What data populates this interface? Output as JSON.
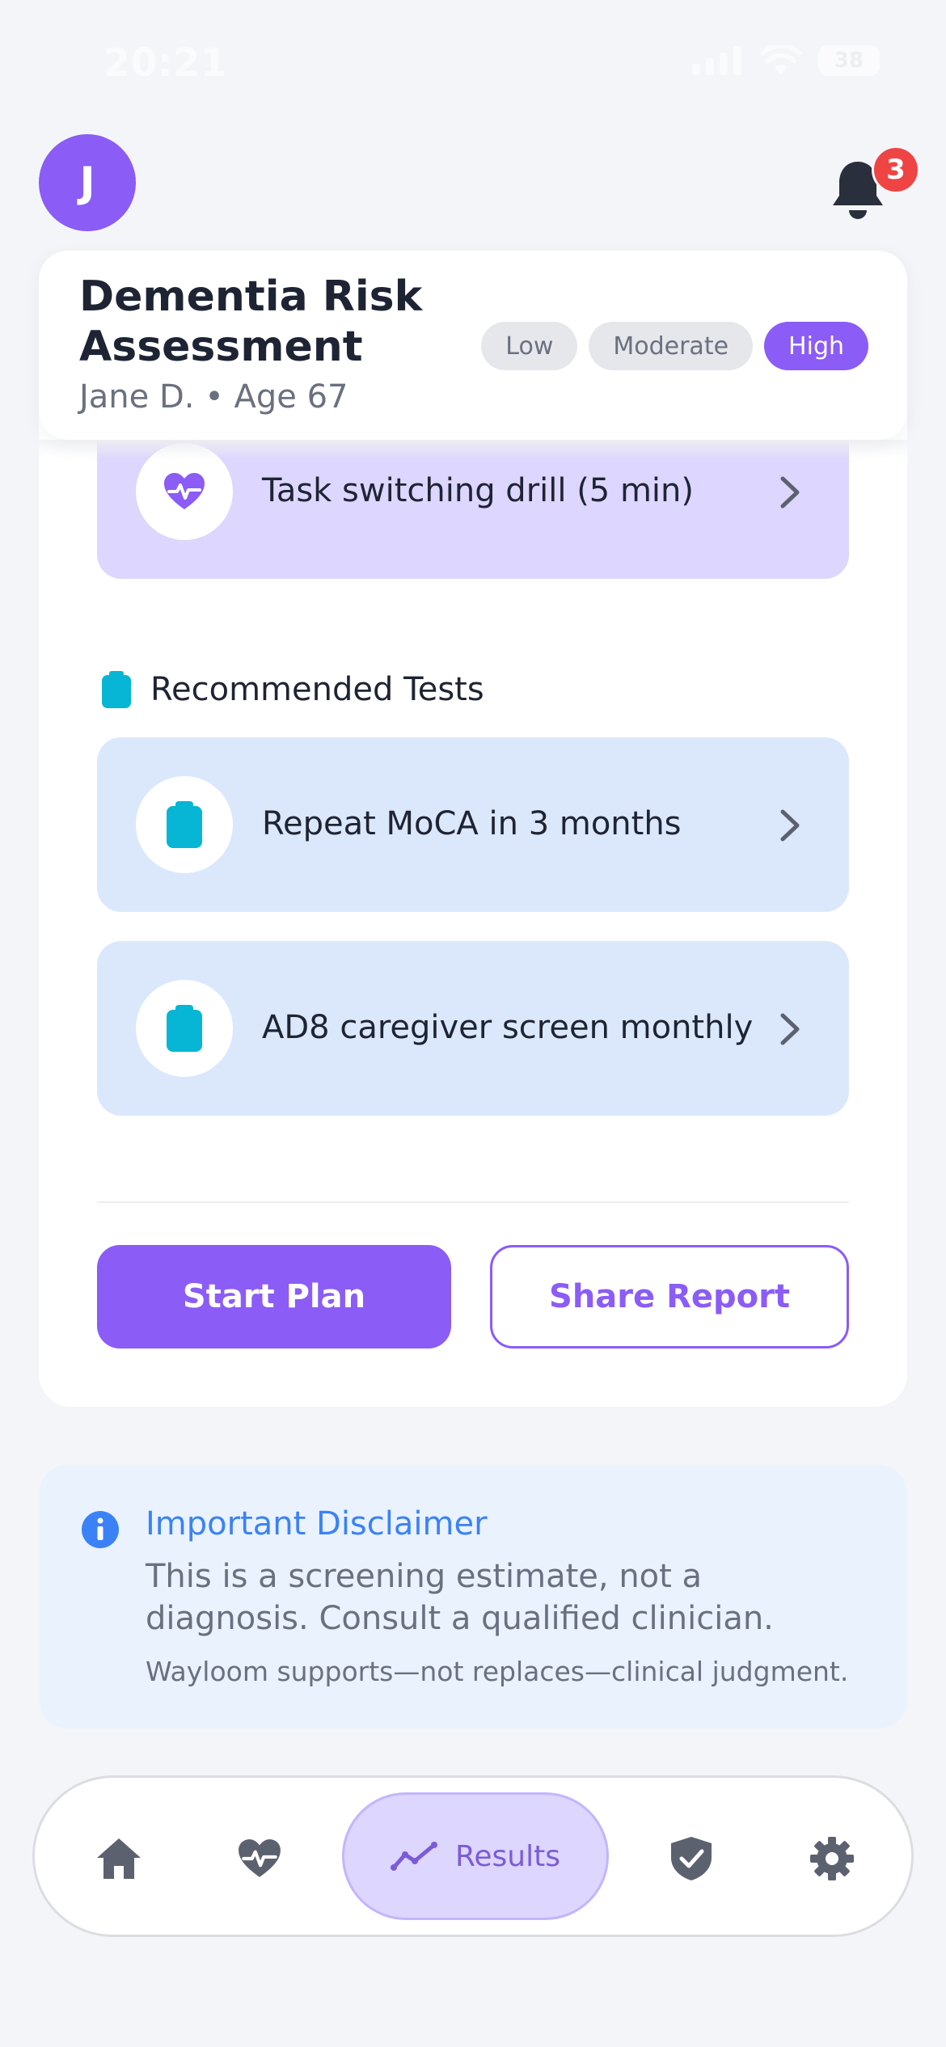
{
  "status_bar": {
    "time": "20:21",
    "battery": "38"
  },
  "header": {
    "avatar_initial": "J",
    "notification_count": "3"
  },
  "assessment": {
    "title": "Dementia Risk Assessment",
    "patient": "Jane D. • Age 67",
    "risk_levels": [
      "Low",
      "Moderate",
      "High"
    ],
    "selected_risk": "High"
  },
  "activities": [
    {
      "label": "Task switching drill (5 min)",
      "icon": "heart-pulse-icon"
    }
  ],
  "recommended_tests": {
    "title": "Recommended Tests",
    "items": [
      {
        "label": "Repeat MoCA in 3 months",
        "icon": "clipboard-icon"
      },
      {
        "label": "AD8 caregiver screen monthly",
        "icon": "clipboard-icon"
      }
    ]
  },
  "actions": {
    "primary": "Start Plan",
    "secondary": "Share Report"
  },
  "disclaimer": {
    "title": "Important Disclaimer",
    "text": "This is a screening estimate, not a diagnosis. Consult a qualified clinician.",
    "note": "Wayloom supports—not replaces—clinical judgment."
  },
  "nav": {
    "items": [
      "home-icon",
      "heart-pulse-icon",
      "results",
      "shield-check-icon",
      "gear-icon"
    ],
    "active_label": "Results"
  },
  "colors": {
    "accent": "#8b5cf6",
    "purple_tint": "#ddd6fe",
    "blue_tint": "#dbe8fc",
    "teal_icon": "#06b6d4",
    "info_blue": "#3b82f6",
    "badge_red": "#ef4444"
  }
}
